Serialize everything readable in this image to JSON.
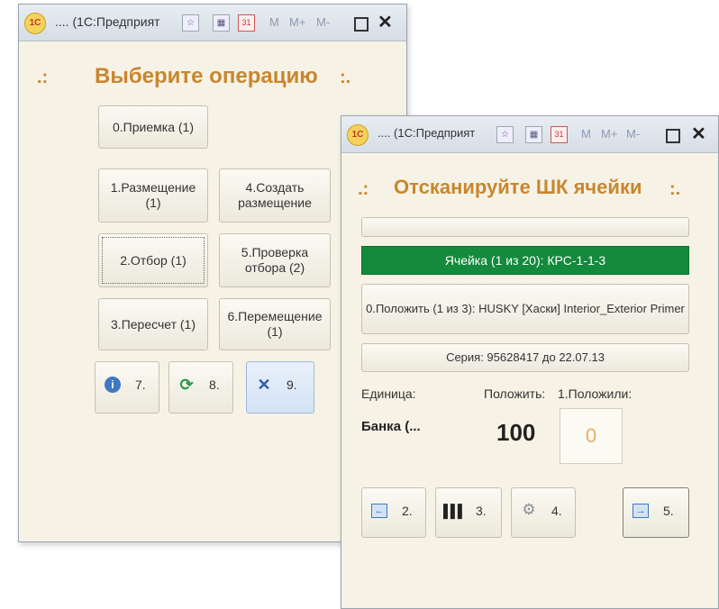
{
  "window1": {
    "title": ".... (1С:Предприят",
    "heading": "Выберите операцию",
    "deco_left": ".:",
    "deco_right": ":.",
    "buttons": [
      "0.Приемка (1)",
      "1.Размещение (1)",
      "4.Создать размещение",
      "2.Отбор (1)",
      "5.Проверка отбора (2)",
      "3.Пересчет (1)",
      "6.Перемещение (1)"
    ],
    "small_buttons": [
      {
        "label": "7.",
        "icon": "info-icon"
      },
      {
        "label": "8.",
        "icon": "refresh-icon"
      },
      {
        "label": "9.",
        "icon": "close-icon"
      }
    ]
  },
  "window2": {
    "title": ".... (1С:Предприят",
    "heading": "Отсканируйте ШК ячейки",
    "deco_left": ".:",
    "deco_right": ":.",
    "cell_text": "Ячейка (1 из 20): КРС-1-1-3",
    "place_text": "0.Положить (1 из 3): HUSKY [Хаски] Interior_Exterior Primer",
    "series_text": "Серия: 95628417 до 22.07.13",
    "unit_label": "Единица:",
    "put_label": "Положить:",
    "placed_label": "1.Положили:",
    "unit_value": "Банка (...",
    "put_value": "100",
    "placed_value": "0",
    "small_buttons": [
      {
        "label": "2.",
        "icon": "back-icon"
      },
      {
        "label": "3.",
        "icon": "barcode-icon"
      },
      {
        "label": "4.",
        "icon": "gear-icon"
      },
      {
        "label": "5.",
        "icon": "forward-icon"
      }
    ]
  },
  "titlebar": {
    "memory_labels": [
      "M",
      "M+",
      "M-"
    ],
    "calendar_text": "31",
    "logo_text": "1С"
  },
  "colors": {
    "accent": "#c9862e",
    "cell_green": "#138a3c",
    "background": "#f6f3e6"
  }
}
